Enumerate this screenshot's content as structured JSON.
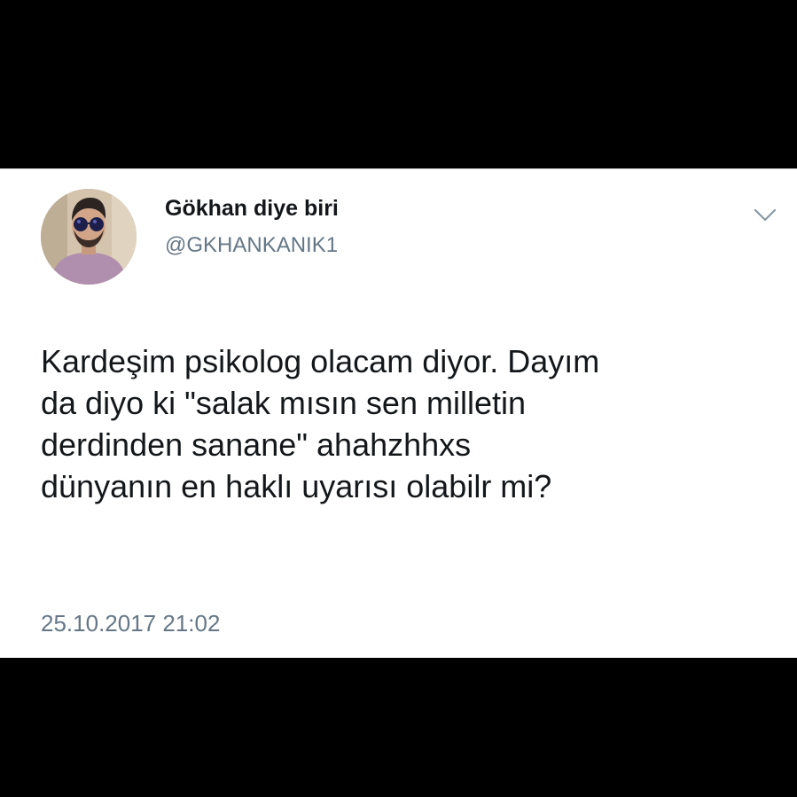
{
  "tweet": {
    "display_name": "Gökhan diye biri",
    "handle": "@GKHANKANIK1",
    "text_lines": [
      "Kardeşim psikolog olacam diyor. Dayım",
      "da diyo ki \"salak mısın sen milletin",
      "derdinden sanane\" ahahzhhxs",
      "dünyanın en haklı uyarısı olabilr mi?"
    ],
    "timestamp": "25.10.2017 21:02",
    "menu_icon": "chevron-down-icon"
  },
  "colors": {
    "background": "#000000",
    "card": "#ffffff",
    "text": "#14171a",
    "secondary_text": "#657786",
    "chevron": "#8899a6"
  }
}
